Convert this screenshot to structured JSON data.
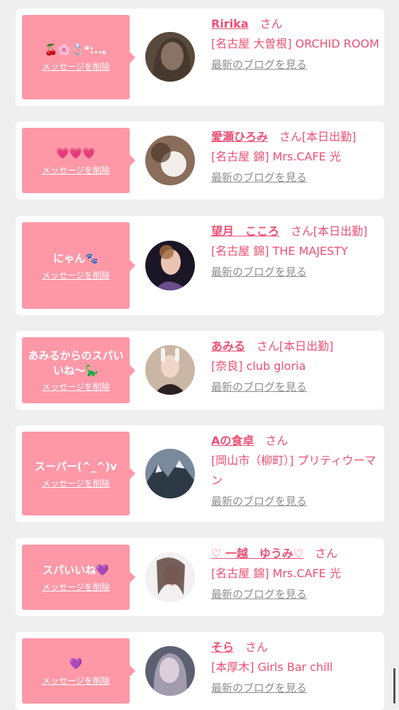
{
  "delete_label": "メッセージを削除",
  "san": "さん",
  "blog_label": "最新のブログを見る",
  "cards": [
    {
      "message": "🍒🌸💍*:..｡",
      "name": "Ririka",
      "status": "",
      "shop": "[名古屋 大曽根] ORCHID ROOM"
    },
    {
      "message": "💗💗💗",
      "name": "愛瀬ひろみ",
      "status": "[本日出勤]",
      "shop": "[名古屋 錦] Mrs.CAFE 光"
    },
    {
      "message": "にゃん🐾",
      "name": "望月　こころ",
      "status": "[本日出勤]",
      "shop": "[名古屋 錦] THE MAJESTY"
    },
    {
      "message": "あみるからのスパいいね〜🦕",
      "name": "あみる",
      "status": "[本日出勤]",
      "shop": "[奈良] club gloria"
    },
    {
      "message": "スーパー(^_^)v",
      "name": "Aの食卓",
      "status": "",
      "shop": "[岡山市（柳町）] プリティウーマン"
    },
    {
      "message": "スパいいね💜",
      "name": "♡ 一越　ゆうみ♡",
      "status": "",
      "shop": "[名古屋 錦] Mrs.CAFE 光"
    },
    {
      "message": "💜",
      "name": "そら",
      "status": "",
      "shop": "[本厚木] Girls Bar chill"
    }
  ]
}
